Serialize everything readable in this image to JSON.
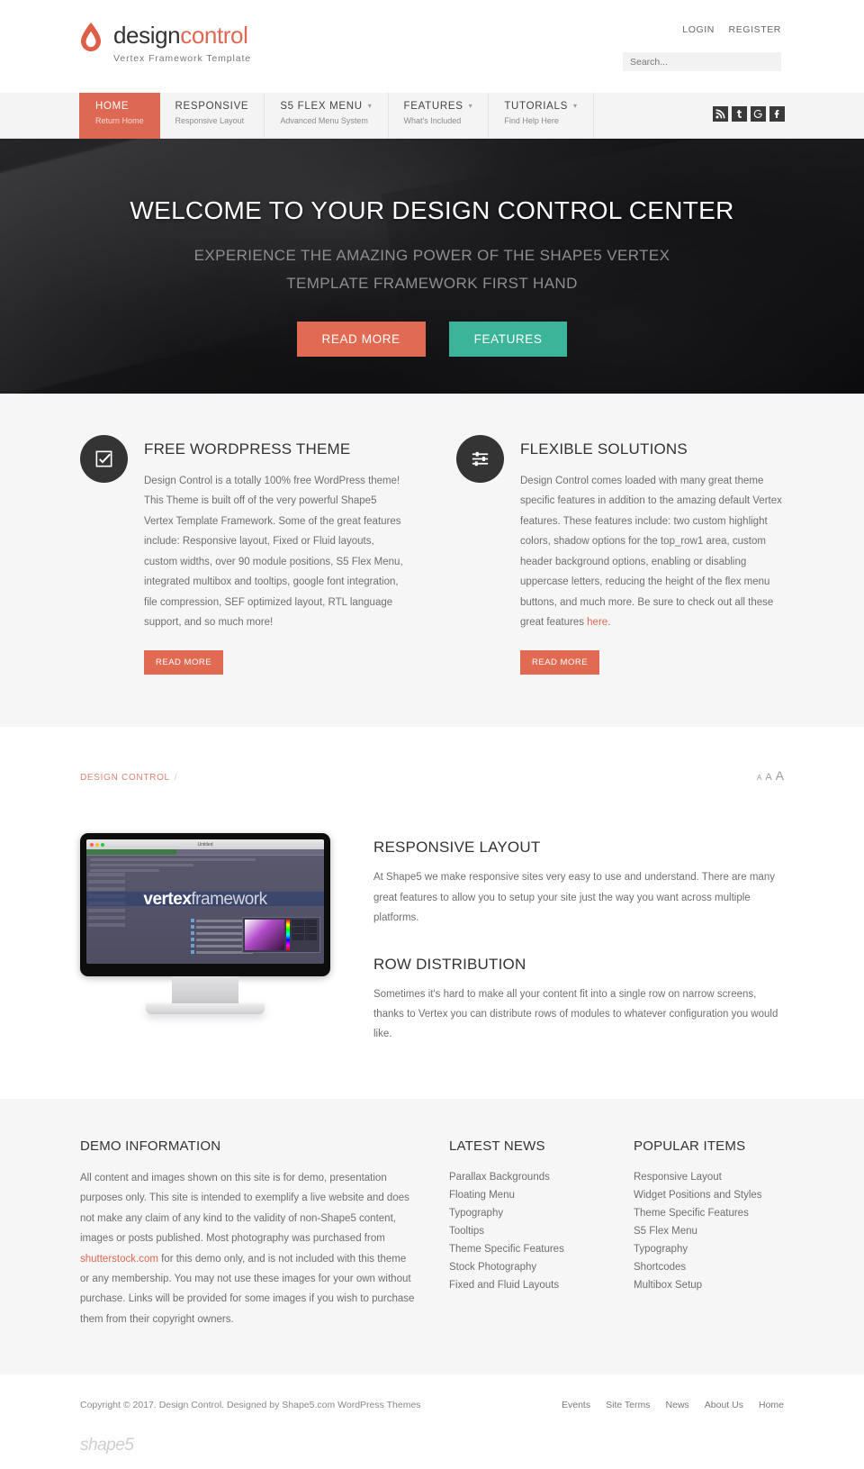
{
  "header": {
    "logo": {
      "icon": "water-drop-icon",
      "name_part1": "design",
      "name_part2": "control",
      "tagline": "Vertex Framework Template"
    },
    "auth": {
      "login": "LOGIN",
      "register": "REGISTER"
    },
    "search": {
      "placeholder": "Search...",
      "value": "",
      "icon": "search-icon"
    }
  },
  "nav": {
    "items": [
      {
        "label": "HOME",
        "sub": "Return Home",
        "active": true,
        "caret": false
      },
      {
        "label": "RESPONSIVE",
        "sub": "Responsive Layout",
        "active": false,
        "caret": false
      },
      {
        "label": "S5 FLEX MENU",
        "sub": "Advanced Menu System",
        "active": false,
        "caret": true
      },
      {
        "label": "FEATURES",
        "sub": "What's Included",
        "active": false,
        "caret": true
      },
      {
        "label": "TUTORIALS",
        "sub": "Find Help Here",
        "active": false,
        "caret": true
      }
    ],
    "caret_glyph": "▾",
    "social": [
      {
        "name": "rss-icon",
        "title": "RSS"
      },
      {
        "name": "twitter-icon",
        "title": "Twitter"
      },
      {
        "name": "google-plus-icon",
        "title": "Google Plus"
      },
      {
        "name": "facebook-icon",
        "title": "Facebook"
      }
    ]
  },
  "hero": {
    "title": "WELCOME TO YOUR DESIGN CONTROL CENTER",
    "subtitle_line1": "EXPERIENCE THE AMAZING POWER OF THE SHAPE5 VERTEX",
    "subtitle_line2": "TEMPLATE FRAMEWORK FIRST HAND",
    "button_primary": "READ MORE",
    "button_secondary": "FEATURES"
  },
  "features": [
    {
      "icon": "checkbox-icon",
      "title": "FREE WORDPRESS THEME",
      "body": "Design Control is a totally 100% free WordPress theme! This Theme is built off of the very powerful Shape5 Vertex Template Framework. Some of the great features include: Responsive layout, Fixed or Fluid layouts, custom widths, over 90 module positions, S5 Flex Menu, integrated multibox and tooltips, google font integration, file compression, SEF optimized layout, RTL language support, and so much more!",
      "link_text": "",
      "body_tail": "",
      "button": "READ MORE"
    },
    {
      "icon": "sliders-icon",
      "title": "FLEXIBLE SOLUTIONS",
      "body": "Design Control comes loaded with many great theme specific features in addition to the amazing default Vertex features. These features include: two custom highlight colors, shadow options for the top_row1 area, custom header background options, enabling or disabling uppercase letters, reducing the height of the flex menu buttons, and much more. Be sure to check out all these great features ",
      "link_text": "here",
      "body_tail": ".",
      "button": "READ MORE"
    }
  ],
  "main": {
    "breadcrumb": "DESIGN CONTROL",
    "breadcrumb_sep": "/",
    "fontsize": {
      "small": "A",
      "medium": "A",
      "large": "A"
    },
    "monitor": {
      "window_title": "Untitled",
      "logo_bold": "vertex",
      "logo_light": "framework"
    },
    "sections": [
      {
        "title": "RESPONSIVE LAYOUT",
        "body": "At Shape5 we make responsive sites very easy to use and understand. There are many great features to allow you to setup your site just the way you want across multiple platforms."
      },
      {
        "title": "ROW DISTRIBUTION",
        "body": "Sometimes it's hard to make all your content fit into a single row on narrow screens, thanks to Vertex you can distribute rows of modules to whatever configuration you would like."
      }
    ]
  },
  "footer_widgets": {
    "demo": {
      "title": "DEMO INFORMATION",
      "body_part1": "All content and images shown on this site is for demo, presentation purposes only. This site is intended to exemplify a live website and does not make any claim of any kind to the validity of non-Shape5 content, images or posts published. Most photography was purchased from ",
      "link_text": "shutterstock.com",
      "body_part2": " for this demo only, and is not included with this theme or any membership. You may not use these images for your own without purchase. Links will be provided for some images if you wish to purchase them from their copyright owners."
    },
    "latest_news": {
      "title": "LATEST NEWS",
      "items": [
        "Parallax Backgrounds",
        "Floating Menu",
        "Typography",
        "Tooltips",
        "Theme Specific Features",
        "Stock Photography",
        "Fixed and Fluid Layouts"
      ]
    },
    "popular_items": {
      "title": "POPULAR ITEMS",
      "items": [
        "Responsive Layout",
        "Widget Positions and Styles",
        "Theme Specific Features",
        "S5 Flex Menu",
        "Typography",
        "Shortcodes",
        "Multibox Setup"
      ]
    }
  },
  "footer": {
    "copyright": "Copyright © 2017. Design Control. Designed by Shape5.com WordPress Themes",
    "links": [
      "Events",
      "Site Terms",
      "News",
      "About Us",
      "Home"
    ],
    "brand": "shape5"
  },
  "colors": {
    "accent": "#dd6853",
    "accent_button": "#e06a52",
    "teal": "#3cb49a",
    "dark": "#343434",
    "light_section": "#f6f6f6",
    "nav_bg": "#f4f4f4"
  }
}
